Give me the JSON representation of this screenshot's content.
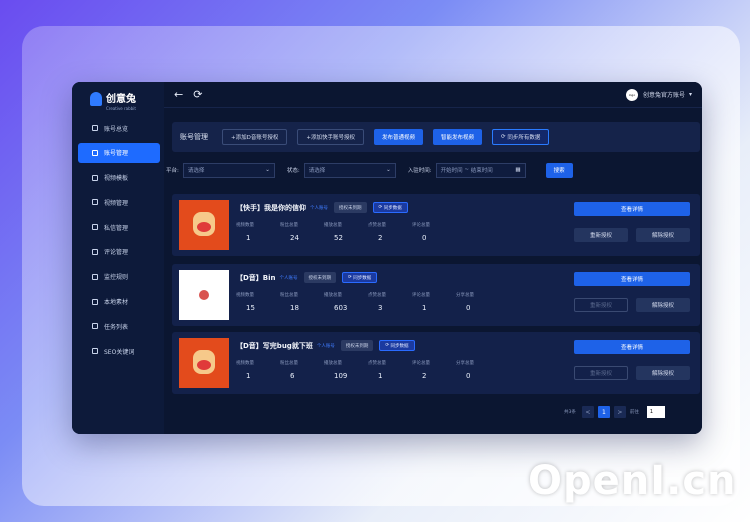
{
  "brand": {
    "name": "创意兔",
    "sub": "Creative rabbit"
  },
  "sidebar": {
    "items": [
      {
        "label": "账号总览",
        "icon": "home-icon",
        "active": false
      },
      {
        "label": "账号管理",
        "icon": "user-icon",
        "active": true
      },
      {
        "label": "视频模板",
        "icon": "video-icon",
        "active": false
      },
      {
        "label": "视频管理",
        "icon": "film-icon",
        "active": false
      },
      {
        "label": "私信管理",
        "icon": "message-icon",
        "active": false
      },
      {
        "label": "评论管理",
        "icon": "comment-icon",
        "active": false
      },
      {
        "label": "监控规则",
        "icon": "monitor-icon",
        "active": false
      },
      {
        "label": "本地素材",
        "icon": "folder-icon",
        "active": false
      },
      {
        "label": "任务列表",
        "icon": "list-icon",
        "active": false
      },
      {
        "label": "SEO关键词",
        "icon": "tag-icon",
        "active": false
      }
    ]
  },
  "topbar": {
    "user_name": "创意兔官方账号",
    "avatar_text": "logo"
  },
  "toolbar": {
    "title": "账号管理",
    "add_douyin": "+添加D音账号授权",
    "add_kuaishou": "+添加快手账号授权",
    "publish_video": "发布普通视频",
    "smart_publish": "智能发布视频",
    "sync_all": "同步所有数据"
  },
  "filters": {
    "platform_label": "平台:",
    "platform_placeholder": "请选择",
    "status_label": "状态:",
    "status_placeholder": "请选择",
    "time_label": "入驻时间:",
    "start_placeholder": "开始时间",
    "sep": "~",
    "end_placeholder": "结束时间",
    "search": "搜索"
  },
  "stat_labels": [
    "视频数量",
    "粉丝总量",
    "播放总量",
    "点赞总量",
    "评论总量",
    "分享总量"
  ],
  "cards": [
    {
      "name": "【快手】我是你的信仰",
      "tag": "个人账号",
      "auth": "授权未到期",
      "sync": "同步数据",
      "values": [
        "1",
        "24",
        "52",
        "2",
        "0"
      ],
      "detail": "查看详情",
      "reauth": "重新授权",
      "unauth": "解除授权"
    },
    {
      "name": "【D音】Bin",
      "tag": "个人账号",
      "auth": "授权未到期",
      "sync": "同步数据",
      "values": [
        "15",
        "18",
        "603",
        "3",
        "1",
        "0"
      ],
      "detail": "查看详情",
      "reauth": "重新授权",
      "unauth": "解除授权"
    },
    {
      "name": "【D音】写完bug就下班",
      "tag": "个人账号",
      "auth": "授权未到期",
      "sync": "同步数据",
      "values": [
        "1",
        "6",
        "109",
        "1",
        "2",
        "0"
      ],
      "detail": "查看详情",
      "reauth": "重新授权",
      "unauth": "解除授权"
    }
  ],
  "pager": {
    "total": "共3条",
    "prev": "<",
    "page": "1",
    "next": ">",
    "goto": "前往",
    "value": "1"
  },
  "watermark": "OpenI.cn"
}
